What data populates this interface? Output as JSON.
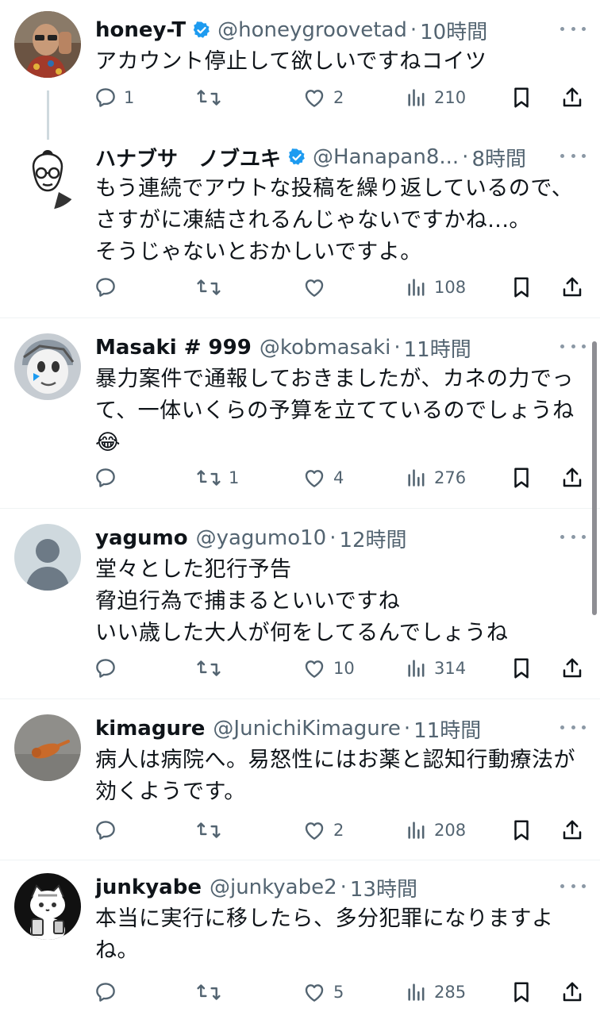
{
  "tweets": [
    {
      "name": "honey-T",
      "verified": true,
      "handle": "@honeygroovetad",
      "time": "10時間",
      "lines": [
        "アカウント停止して欲しいですねコイツ"
      ],
      "replies": "1",
      "retweets": "",
      "likes": "2",
      "views": "210",
      "avatar_icon": "photo-avatar-man-glasses"
    },
    {
      "name": "ハナブサ　ノブユキ",
      "verified": true,
      "handle": "@Hanapan8...",
      "time": "8時間",
      "lines": [
        "もう連続でアウトな投稿を繰り返しているので、",
        "さすがに凍結されるんじゃないですかね...。",
        "そうじゃないとおかしいですよ。"
      ],
      "replies": "",
      "retweets": "",
      "likes": "",
      "views": "108",
      "avatar_icon": "illustrated-avatar-glasses"
    },
    {
      "name": "Masaki # 999",
      "verified": false,
      "handle": "@kobmasaki",
      "time": "11時間",
      "lines": [
        "暴力案件で通報しておきましたが、カネの力でっ",
        "て、一体いくらの予算を立てているのでしょうね",
        "😂"
      ],
      "replies": "",
      "retweets": "1",
      "likes": "4",
      "views": "276",
      "avatar_icon": "cartoon-avatar-bird"
    },
    {
      "name": "yagumo",
      "verified": false,
      "handle": "@yagumo10",
      "time": "12時間",
      "lines": [
        "堂々とした犯行予告",
        "脅迫行為で捕まるといいですね",
        "いい歳した大人が何をしてるんでしょうね"
      ],
      "replies": "",
      "retweets": "",
      "likes": "10",
      "views": "314",
      "avatar_icon": "default-avatar"
    },
    {
      "name": "kimagure",
      "verified": false,
      "handle": "@JunichiKimagure",
      "time": "11時間",
      "lines": [
        "病人は病院へ。易怒性にはお薬と認知行動療法が",
        "効くようです。"
      ],
      "replies": "",
      "retweets": "",
      "likes": "2",
      "views": "208",
      "avatar_icon": "photo-avatar-cat"
    },
    {
      "name": "junkyabe",
      "verified": false,
      "handle": "@junkyabe2",
      "time": "13時間",
      "lines": [
        "本当に実行に移したら、多分犯罪になりますよ",
        "ね。"
      ],
      "replies": "",
      "retweets": "",
      "likes": "5",
      "views": "285",
      "avatar_icon": "illustrated-avatar-cat"
    }
  ],
  "colors": {
    "text": "#0f1419",
    "secondary": "#536471",
    "verified": "#1d9bf0",
    "separator": "#eff3f4"
  }
}
